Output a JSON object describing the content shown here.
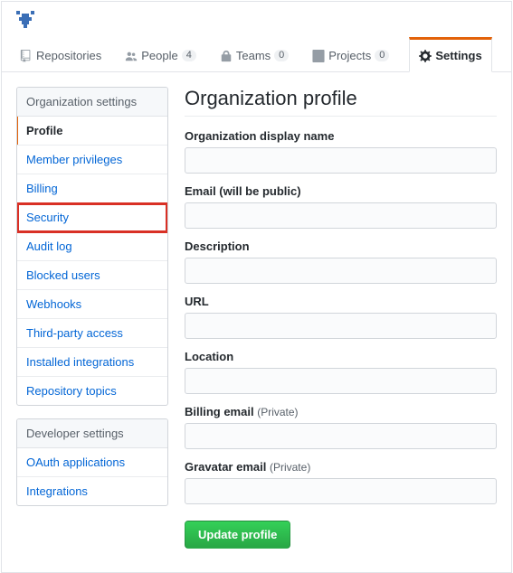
{
  "tabs": {
    "repositories": {
      "label": "Repositories"
    },
    "people": {
      "label": "People",
      "count": "4"
    },
    "teams": {
      "label": "Teams",
      "count": "0"
    },
    "projects": {
      "label": "Projects",
      "count": "0"
    },
    "settings": {
      "label": "Settings"
    }
  },
  "sidebar": {
    "org_header": "Organization settings",
    "dev_header": "Developer settings",
    "org_items": [
      "Profile",
      "Member privileges",
      "Billing",
      "Security",
      "Audit log",
      "Blocked users",
      "Webhooks",
      "Third-party access",
      "Installed integrations",
      "Repository topics"
    ],
    "dev_items": [
      "OAuth applications",
      "Integrations"
    ]
  },
  "main": {
    "title": "Organization profile",
    "fields": {
      "display_name": {
        "label": "Organization display name",
        "value": ""
      },
      "email": {
        "label": "Email (will be public)",
        "value": ""
      },
      "description": {
        "label": "Description",
        "value": ""
      },
      "url": {
        "label": "URL",
        "value": ""
      },
      "location": {
        "label": "Location",
        "value": ""
      },
      "billing_email": {
        "label": "Billing email",
        "meta": "(Private)",
        "value": ""
      },
      "gravatar_email": {
        "label": "Gravatar email",
        "meta": "(Private)",
        "value": ""
      }
    },
    "submit_label": "Update profile"
  }
}
